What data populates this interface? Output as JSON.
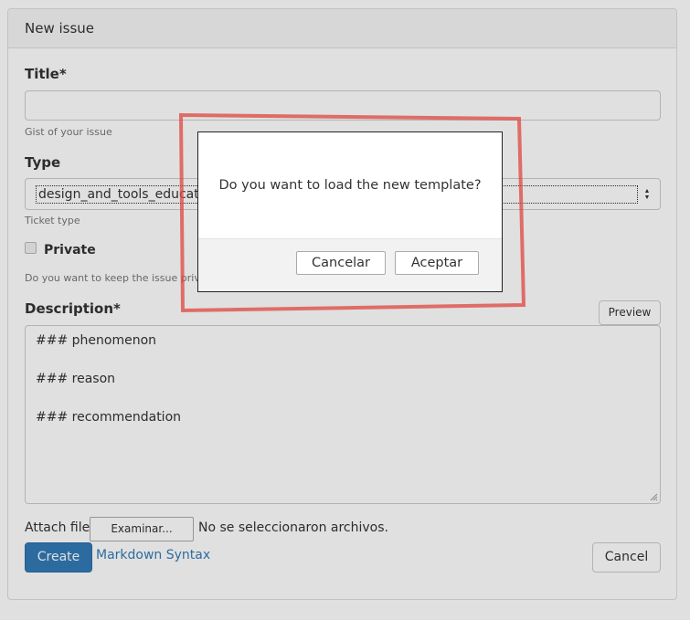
{
  "panel": {
    "title": "New issue"
  },
  "form": {
    "title_label": "Title*",
    "title_value": "",
    "title_help": "Gist of your issue",
    "type_label": "Type",
    "type_value": "design_and_tools_education",
    "type_help": "Ticket type",
    "private_label": "Private",
    "private_checked": false,
    "private_help": "Do you want to keep the issue private?",
    "description_label": "Description*",
    "preview_button": "Preview",
    "description_lines": [
      "### phenomenon",
      "",
      "### reason",
      "",
      "### recommendation"
    ],
    "attach_label": "Attach file",
    "browse_button": "Examinar...",
    "no_file_text": "No se seleccionaron archivos.",
    "create_button": "Create",
    "markdown_link": "Markdown Syntax",
    "cancel_button": "Cancel"
  },
  "dialog": {
    "message": "Do you want to load the new template?",
    "cancel_button": "Cancelar",
    "accept_button": "Aceptar"
  },
  "colors": {
    "primary": "#337ab7",
    "annotation": "#e0453f"
  },
  "icons": {
    "select_arrows": "up-down-arrows-icon",
    "resize": "resize-grip-icon"
  }
}
